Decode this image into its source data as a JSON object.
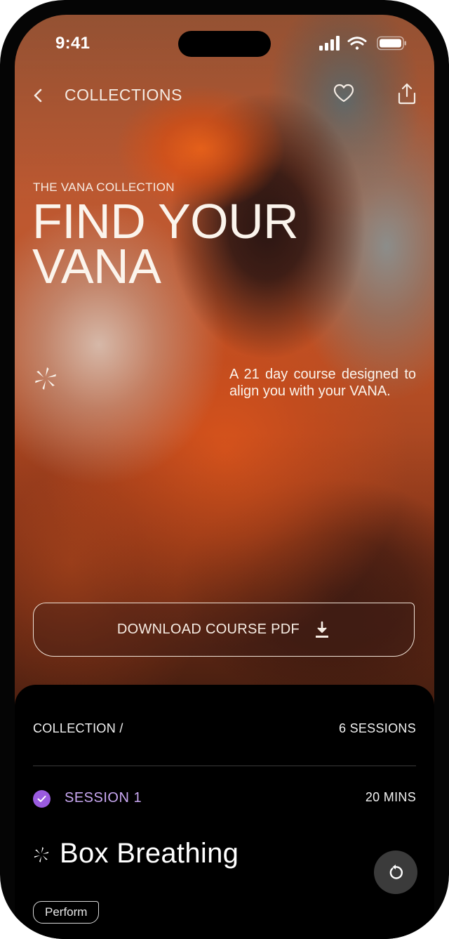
{
  "status_bar": {
    "time": "9:41"
  },
  "nav": {
    "title": "COLLECTIONS"
  },
  "hero": {
    "eyebrow": "THE VANA COLLECTION",
    "headline": "FIND YOUR VANA",
    "description": "A 21 day course designed to align you with your VANA."
  },
  "download_button": {
    "label": "DOWNLOAD COURSE PDF"
  },
  "collection": {
    "label": "COLLECTION /",
    "sessions_count": "6 SESSIONS"
  },
  "session": {
    "label": "SESSION 1",
    "duration": "20 MINS",
    "title": "Box Breathing",
    "tag": "Perform",
    "completed": true
  },
  "colors": {
    "accent_purple": "#9a5be0",
    "session_label": "#c9a8f2",
    "background": "#000000",
    "text_light": "#fbf4ec"
  },
  "icons": {
    "back": "chevron-left-icon",
    "favorite": "heart-icon",
    "share": "share-icon",
    "brand": "vana-star-icon",
    "download": "download-icon",
    "check": "check-icon",
    "replay": "replay-icon"
  }
}
